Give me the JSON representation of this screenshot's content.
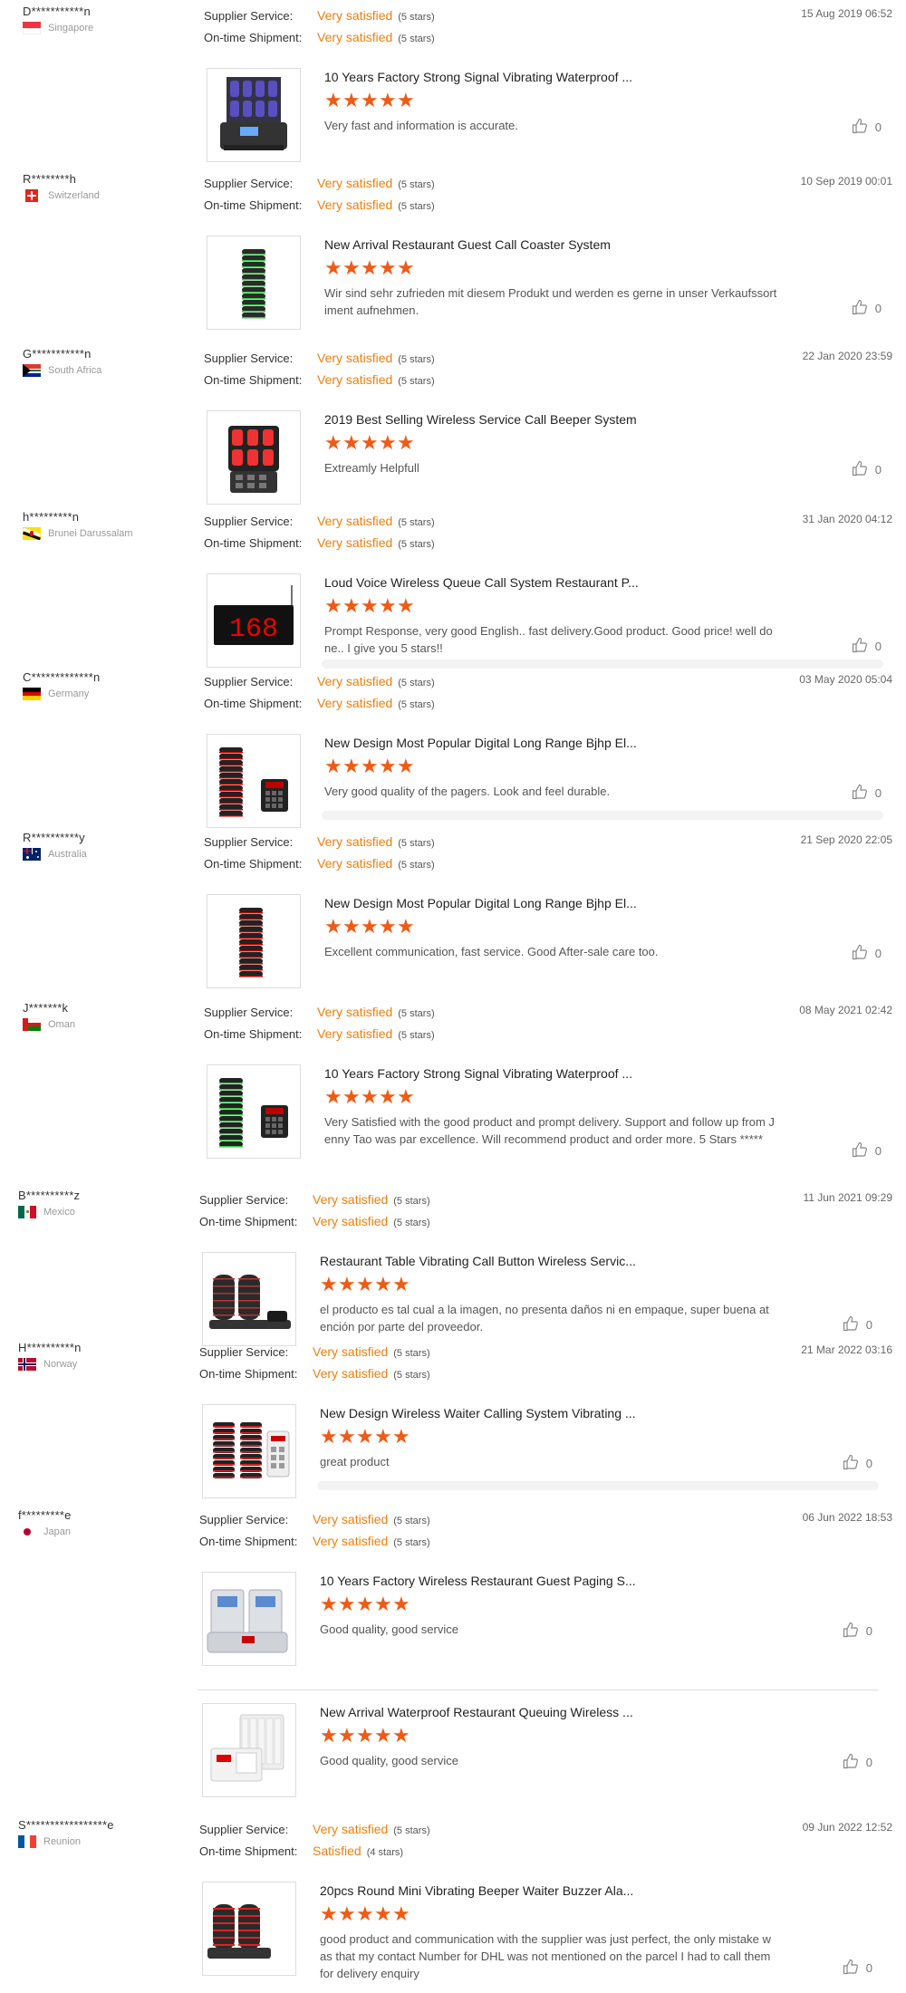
{
  "labels": {
    "supplier_service": "Supplier Service:",
    "ontime_shipment": "On-time Shipment:"
  },
  "reviews": [
    {
      "buyer": "D***********n",
      "country": "Singapore",
      "supplier": "Very satisfied",
      "supplier_stars": "(5 stars)",
      "shipment": "Very satisfied",
      "shipment_stars": "(5 stars)",
      "date": "15 Aug 2019 06:52",
      "products": [
        {
          "title": "10 Years Factory Strong Signal Vibrating Waterproof ...",
          "rating": 5,
          "text": "Very fast and information is accurate.",
          "likes": "0"
        }
      ]
    },
    {
      "buyer": "R********h",
      "country": "Switzerland",
      "supplier": "Very satisfied",
      "supplier_stars": "(5 stars)",
      "shipment": "Very satisfied",
      "shipment_stars": "(5 stars)",
      "date": "10 Sep 2019 00:01",
      "products": [
        {
          "title": "New Arrival Restaurant Guest Call Coaster System",
          "rating": 5,
          "text": "Wir sind sehr zufrieden mit diesem Produkt und werden es gerne in unser Verkaufssortiment aufnehmen.",
          "likes": "0"
        }
      ]
    },
    {
      "buyer": "G***********n",
      "country": "South Africa",
      "supplier": "Very satisfied",
      "supplier_stars": "(5 stars)",
      "shipment": "Very satisfied",
      "shipment_stars": "(5 stars)",
      "date": "22 Jan 2020 23:59",
      "products": [
        {
          "title": "2019 Best Selling Wireless Service Call Beeper System",
          "rating": 5,
          "text": "Extreamly Helpfull",
          "likes": "0"
        }
      ]
    },
    {
      "buyer": "h*********n",
      "country": "Brunei Darussalam",
      "supplier": "Very satisfied",
      "supplier_stars": "(5 stars)",
      "shipment": "Very satisfied",
      "shipment_stars": "(5 stars)",
      "date": "31 Jan 2020 04:12",
      "products": [
        {
          "title": "Loud Voice Wireless Queue Call System Restaurant P...",
          "rating": 5,
          "text": "Prompt Response, very good English.. fast delivery.Good product. Good price! well done.. I give you 5 stars!!",
          "likes": "0",
          "display": "168"
        }
      ]
    },
    {
      "buyer": "C*************n",
      "country": "Germany",
      "supplier": "Very satisfied",
      "supplier_stars": "(5 stars)",
      "shipment": "Very satisfied",
      "shipment_stars": "(5 stars)",
      "date": "03 May 2020 05:04",
      "products": [
        {
          "title": "New Design Most Popular Digital Long Range Bjhp El...",
          "rating": 5,
          "text": "Very good quality of the pagers. Look and feel durable.",
          "likes": "0"
        }
      ]
    },
    {
      "buyer": "R**********y",
      "country": "Australia",
      "supplier": "Very satisfied",
      "supplier_stars": "(5 stars)",
      "shipment": "Very satisfied",
      "shipment_stars": "(5 stars)",
      "date": "21 Sep 2020 22:05",
      "products": [
        {
          "title": "New Design Most Popular Digital Long Range Bjhp El...",
          "rating": 5,
          "text": "Excellent communication, fast service.  Good After-sale care too.",
          "likes": "0"
        }
      ]
    },
    {
      "buyer": "J*******k",
      "country": "Oman",
      "supplier": "Very satisfied",
      "supplier_stars": "(5 stars)",
      "shipment": "Very satisfied",
      "shipment_stars": "(5 stars)",
      "date": "08 May 2021 02:42",
      "products": [
        {
          "title": "10 Years Factory Strong Signal Vibrating Waterproof ...",
          "rating": 5,
          "text": "Very Satisfied with the good product and prompt delivery. Support and follow up from Jenny Tao was par excellence. Will recommend product and order more. 5 Stars *****",
          "likes": "0"
        }
      ]
    },
    {
      "buyer": "B**********z",
      "country": "Mexico",
      "supplier": "Very satisfied",
      "supplier_stars": "(5 stars)",
      "shipment": "Very satisfied",
      "shipment_stars": "(5 stars)",
      "date": "11 Jun 2021 09:29",
      "products": [
        {
          "title": "Restaurant Table Vibrating Call Button Wireless Servic...",
          "rating": 5,
          "text": "el producto es tal cual a la imagen, no presenta daños ni en empaque, super buena atención por parte del proveedor.",
          "likes": "0"
        }
      ]
    },
    {
      "buyer": "H**********n",
      "country": "Norway",
      "supplier": "Very satisfied",
      "supplier_stars": "(5 stars)",
      "shipment": "Very satisfied",
      "shipment_stars": "(5 stars)",
      "date": "21 Mar 2022 03:16",
      "products": [
        {
          "title": "New Design Wireless Waiter Calling System Vibrating ...",
          "rating": 5,
          "text": "great product",
          "likes": "0"
        }
      ]
    },
    {
      "buyer": "f*********e",
      "country": "Japan",
      "supplier": "Very satisfied",
      "supplier_stars": "(5 stars)",
      "shipment": "Very satisfied",
      "shipment_stars": "(5 stars)",
      "date": "06 Jun 2022 18:53",
      "products": [
        {
          "title": "10 Years Factory Wireless Restaurant Guest Paging S...",
          "rating": 5,
          "text": "Good quality, good service",
          "likes": "0"
        },
        {
          "title": "New Arrival Waterproof Restaurant Queuing Wireless ...",
          "rating": 5,
          "text": "Good quality, good service",
          "likes": "0"
        }
      ]
    },
    {
      "buyer": "S*****************e",
      "country": "Reunion",
      "supplier": "Very satisfied",
      "supplier_stars": "(5 stars)",
      "shipment": "Satisfied",
      "shipment_stars": "(4 stars)",
      "date": "09 Jun 2022 12:52",
      "products": [
        {
          "title": "20pcs Round Mini Vibrating Beeper Waiter Buzzer Ala...",
          "rating": 5,
          "text": "good product and communication with the supplier was just perfect, the only mistake was that my contact Number for DHL was not mentioned on the parcel I had to call them for delivery enquiry",
          "likes": "0"
        }
      ]
    }
  ]
}
